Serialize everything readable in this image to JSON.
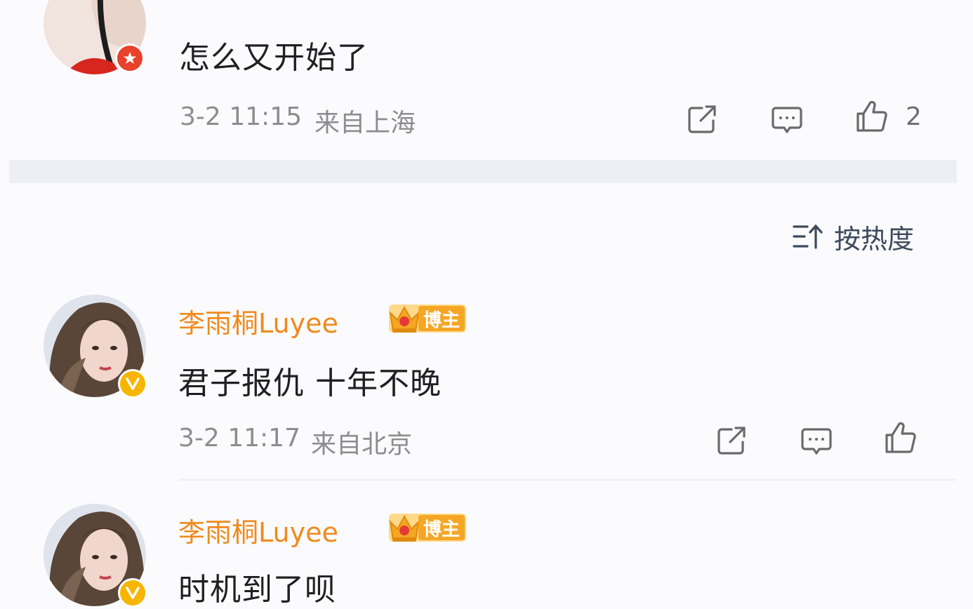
{
  "comments": [
    {
      "text": "怎么又开始了",
      "date": "3-2 11:15",
      "location": "来自上海",
      "likes": "2"
    }
  ],
  "sort": {
    "label": "按热度"
  },
  "replies": [
    {
      "username": "李雨桐Luyee",
      "badge": "博主",
      "text": "君子报仇 十年不晚",
      "date": "3-2 11:17",
      "location": "来自北京"
    },
    {
      "username": "李雨桐Luyee",
      "badge": "博主",
      "text": "时机到了呗"
    }
  ],
  "colors": {
    "username": "#f08a1e",
    "meta": "#8d8d8d",
    "background": "#fbfbfe",
    "divider": "#eceff4",
    "verified_badge": "#f7b500",
    "red_badge": "#e8412c"
  },
  "icons": {
    "share": "share-icon",
    "comment": "comment-icon",
    "like": "like-icon",
    "sort": "sort-icon",
    "verified": "verified-v-icon",
    "crown": "crown-icon"
  }
}
